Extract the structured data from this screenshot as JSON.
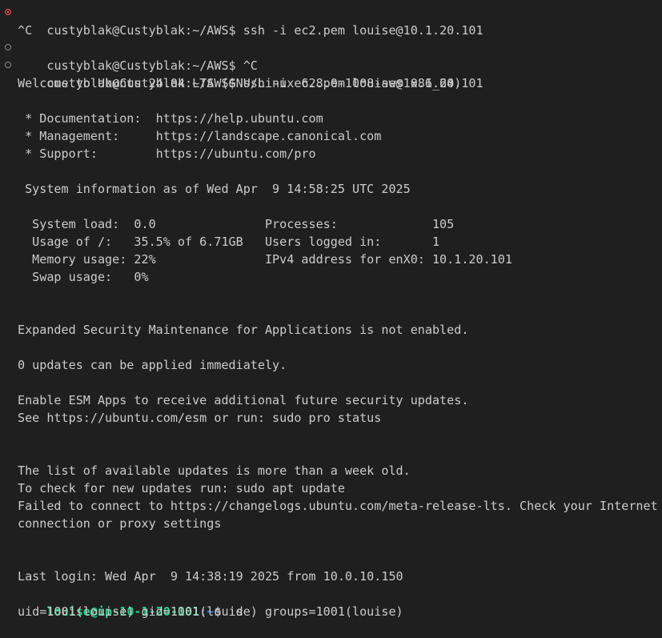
{
  "terminal": {
    "background": "#1f1f1f",
    "foreground": "#cccccc",
    "error_marker_color": "#f14c4c",
    "prompt_user_color": "#23d18b",
    "prompt_path_color": "#3b8eea",
    "lines": [
      "custyblak@Custyblak:~/AWS$ ssh -i ec2.pem louise@10.1.20.101",
      "^C",
      "custyblak@Custyblak:~/AWS$ ^C",
      "custyblak@Custyblak:~/AWS$ ssh -i ec2.pem louise@10.1.20.101",
      "Welcome to Ubuntu 24.04 LTS (GNU/Linux 6.8.0-1008-aws x86_64)",
      "",
      " * Documentation:  https://help.ubuntu.com",
      " * Management:     https://landscape.canonical.com",
      " * Support:        https://ubuntu.com/pro",
      "",
      " System information as of Wed Apr  9 14:58:25 UTC 2025",
      "",
      "  System load:  0.0               Processes:             105",
      "  Usage of /:   35.5% of 6.71GB   Users logged in:       1",
      "  Memory usage: 22%               IPv4 address for enX0: 10.1.20.101",
      "  Swap usage:   0%",
      "",
      "",
      "Expanded Security Maintenance for Applications is not enabled.",
      "",
      "0 updates can be applied immediately.",
      "",
      "Enable ESM Apps to receive additional future security updates.",
      "See https://ubuntu.com/esm or run: sudo pro status",
      "",
      "",
      "The list of available updates is more than a week old.",
      "To check for new updates run: sudo apt update",
      "Failed to connect to https://changelogs.ubuntu.com/meta-release-lts. Check your Internet",
      "connection or proxy settings",
      "",
      "",
      "Last login: Wed Apr  9 14:38:19 2025 from 10.0.10.150"
    ],
    "remote_prompt": {
      "user_host": "louise@ip-10-1-20-101",
      "separator": ":",
      "path": "~",
      "symbol": "$ ",
      "command": "id"
    },
    "output_line": "uid=1001(louise) gid=1001(louise) groups=1001(louise)"
  }
}
